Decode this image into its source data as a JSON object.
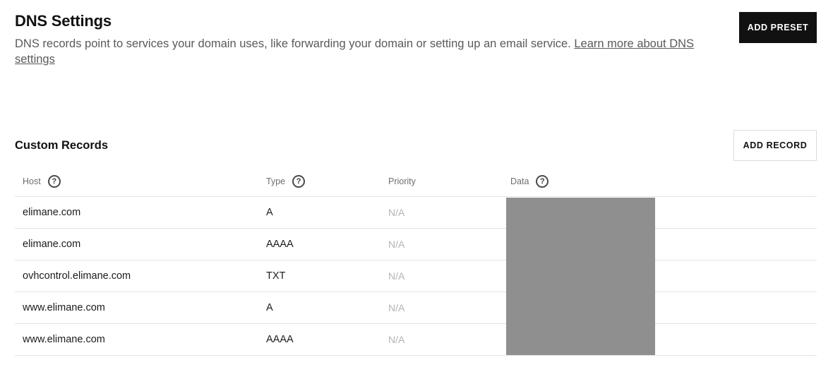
{
  "header": {
    "title": "DNS Settings",
    "description": "DNS records point to services your domain uses, like forwarding your domain or setting up an email service. ",
    "learn_more": "Learn more about DNS settings",
    "add_preset_label": "ADD PRESET"
  },
  "custom_records": {
    "title": "Custom Records",
    "add_record_label": "ADD RECORD",
    "columns": {
      "host": "Host",
      "type": "Type",
      "priority": "Priority",
      "data": "Data"
    },
    "help_glyph": "?",
    "rows": [
      {
        "host": "elimane.com",
        "type": "A",
        "priority": "N/A"
      },
      {
        "host": "elimane.com",
        "type": "AAAA",
        "priority": "N/A"
      },
      {
        "host": "ovhcontrol.elimane.com",
        "type": "TXT",
        "priority": "N/A"
      },
      {
        "host": "www.elimane.com",
        "type": "A",
        "priority": "N/A"
      },
      {
        "host": "www.elimane.com",
        "type": "AAAA",
        "priority": "N/A"
      }
    ]
  },
  "icons": {
    "help": "question-circle-icon"
  }
}
